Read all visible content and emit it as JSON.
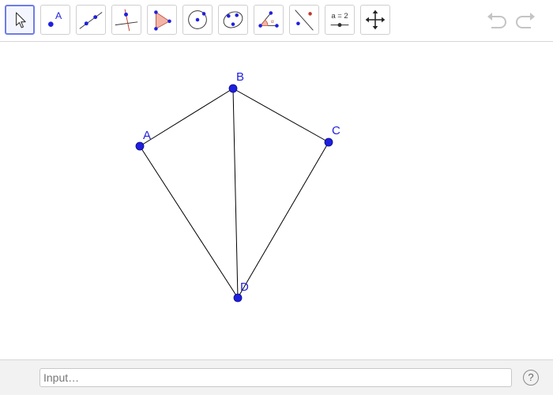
{
  "toolbar": {
    "tools": [
      {
        "icon": "move-cursor-icon",
        "active": true
      },
      {
        "icon": "point-icon",
        "label": "A"
      },
      {
        "icon": "line-icon"
      },
      {
        "icon": "perpendicular-line-icon"
      },
      {
        "icon": "polygon-icon"
      },
      {
        "icon": "circle-center-point-icon"
      },
      {
        "icon": "ellipse-icon"
      },
      {
        "icon": "angle-icon"
      },
      {
        "icon": "reflect-icon"
      },
      {
        "icon": "slider-icon",
        "label": "a = 2"
      },
      {
        "icon": "move-graphics-view-icon"
      }
    ],
    "undo_icon": "undo-icon",
    "redo_icon": "redo-icon"
  },
  "graphics": {
    "points": [
      {
        "name": "A"
      },
      {
        "name": "B"
      },
      {
        "name": "C"
      },
      {
        "name": "D"
      }
    ],
    "segments": [
      "AB",
      "BC",
      "AD",
      "BD",
      "CD"
    ],
    "colors": {
      "point": "#1f1fe0",
      "segment": "#000000",
      "polygon_fill": "#f3b4a8",
      "accent": "#6e7de6"
    }
  },
  "input": {
    "placeholder": "Input…",
    "value": ""
  },
  "help": {
    "label": "?"
  }
}
